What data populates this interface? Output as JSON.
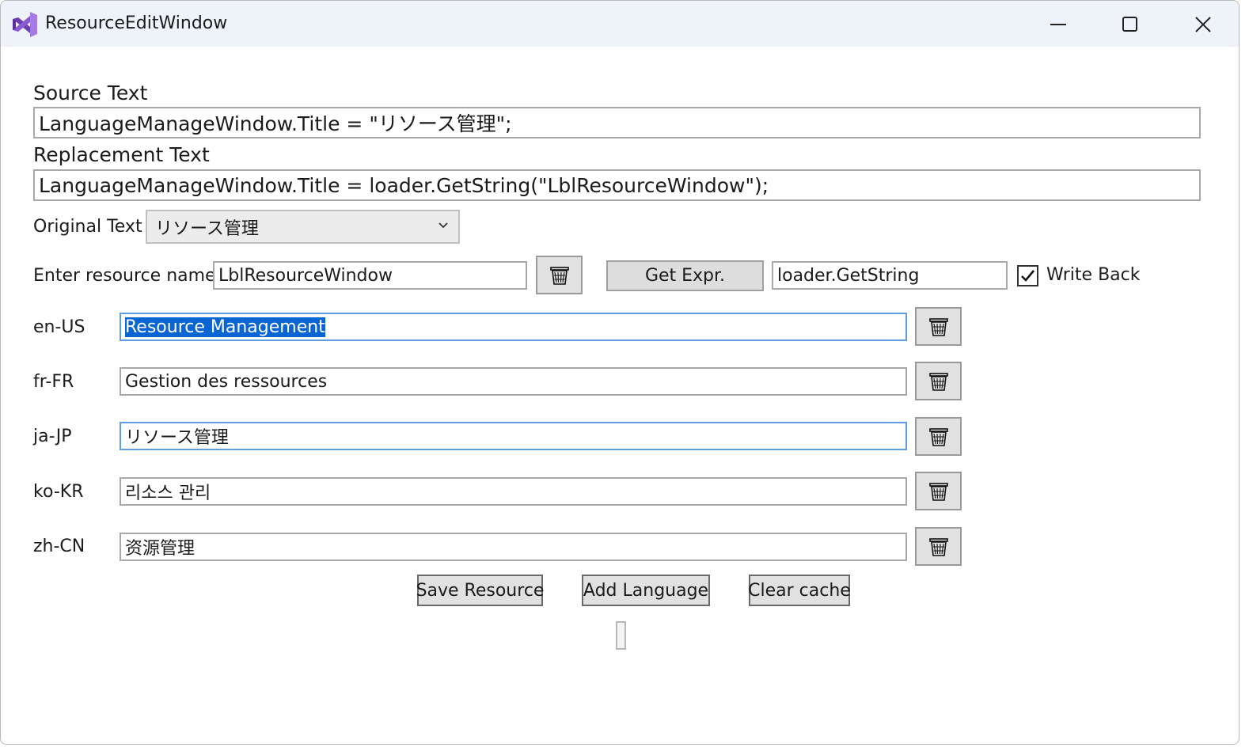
{
  "window": {
    "title": "ResourceEditWindow"
  },
  "source": {
    "label": "Source Text",
    "value": "LanguageManageWindow.Title = \"リソース管理\";"
  },
  "replacement": {
    "label": "Replacement Text",
    "value": "LanguageManageWindow.Title = loader.GetString(\"LblResourceWindow\");"
  },
  "original": {
    "label": "Original Text",
    "selected": "リソース管理"
  },
  "resource": {
    "label": "Enter resource name",
    "name": "LblResourceWindow",
    "get_expr_label": "Get Expr.",
    "expr": "loader.GetString",
    "write_back_label": "Write Back",
    "write_back_checked": true
  },
  "languages": [
    {
      "code": "en-US",
      "value": "Resource Management"
    },
    {
      "code": "fr-FR",
      "value": "Gestion des ressources"
    },
    {
      "code": "ja-JP",
      "value": "リソース管理"
    },
    {
      "code": "ko-KR",
      "value": "리소스 관리"
    },
    {
      "code": "zh-CN",
      "value": "资源管理"
    }
  ],
  "actions": {
    "save": "Save Resource",
    "add_language": "Add Language",
    "clear_cache": "Clear cache"
  },
  "progress": {
    "value": 0
  },
  "colors": {
    "accent": "#0a64d2",
    "focus_border": "#5c9ee0",
    "titlebar": "#eef2f9"
  },
  "icons": {
    "app": "visual-studio-icon",
    "minimize": "minimize-icon",
    "maximize": "maximize-icon",
    "close": "close-icon",
    "delete": "trash-icon",
    "dropdown": "chevron-down-icon",
    "check": "checkmark-icon"
  }
}
